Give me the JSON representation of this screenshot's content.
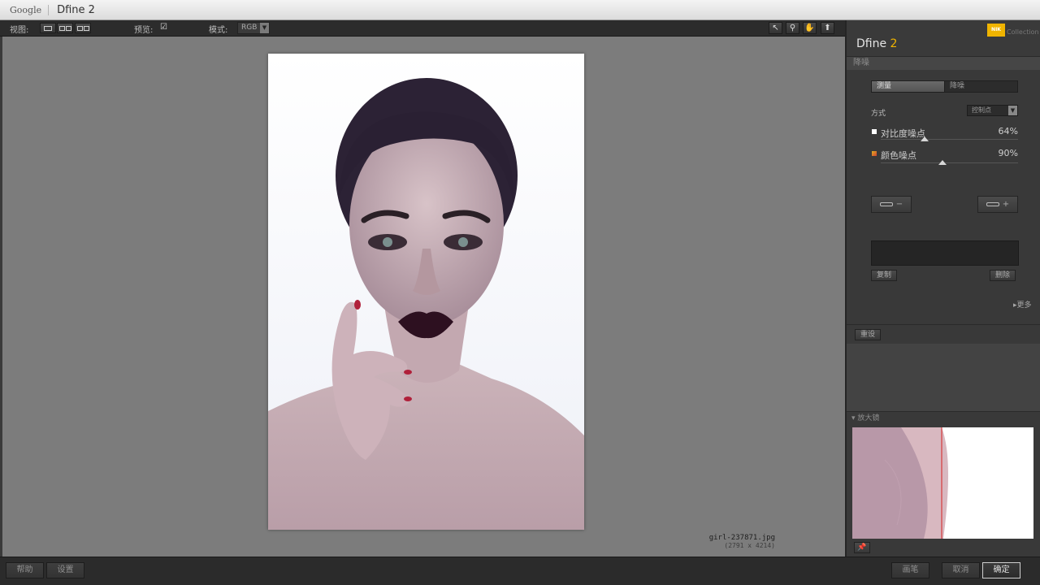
{
  "window": {
    "brand": "Google",
    "title": "Dfine 2"
  },
  "toolbar": {
    "view_label": "视图:",
    "preview_label": "预览:",
    "mode_label": "模式:",
    "mode_value": "RGB"
  },
  "image": {
    "filename": "girl-237871.jpg",
    "dimensions": "(2791 x 4214)"
  },
  "panel": {
    "logo_text": "NIK",
    "collection_text": "Collection",
    "app_name": "Dfine",
    "app_version": "2",
    "noise_title": "降噪",
    "tabs": [
      {
        "label": "测量"
      },
      {
        "label": "降噪"
      }
    ],
    "method_label": "方式",
    "method_value": "控制点",
    "sliders": [
      {
        "name": "对比度噪点",
        "value": "64%",
        "percent": 64,
        "swatch": "#ffffff"
      },
      {
        "name": "颜色噪点",
        "value": "90%",
        "percent": 90,
        "swatch": "#e07020"
      }
    ],
    "copy_label": "复制",
    "delete_label": "删除",
    "more_label": "更多",
    "reset_label": "重设",
    "loupe_title": "放大镜"
  },
  "bottom": {
    "help_label": "帮助",
    "settings_label": "设置",
    "brush_label": "画笔",
    "cancel_label": "取消",
    "ok_label": "确定"
  },
  "colors": {
    "accent": "#f0b400",
    "loupe_line": "#d62020"
  }
}
